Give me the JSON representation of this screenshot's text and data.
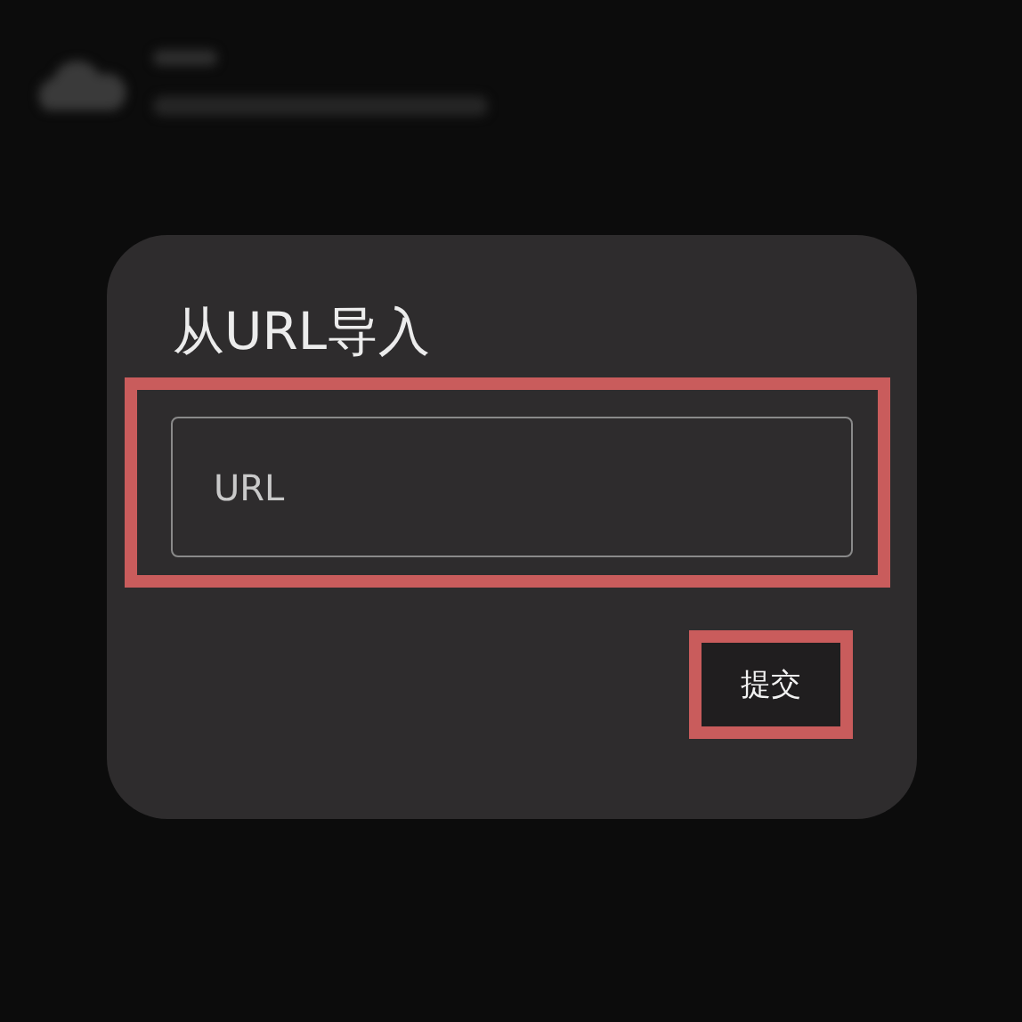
{
  "dialog": {
    "title": "从URL导入",
    "field": {
      "placeholder": "URL",
      "highlighted": true
    },
    "submit_button": {
      "label": "提交",
      "highlighted": true
    }
  }
}
